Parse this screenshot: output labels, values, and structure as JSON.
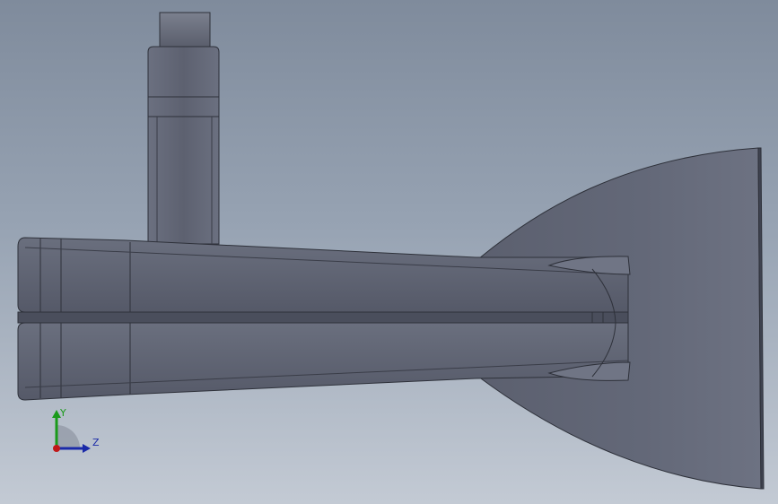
{
  "viewport": {
    "background_top": "#7f8b9c",
    "background_bottom": "#c3cad4"
  },
  "model": {
    "body_color": "#5f6372",
    "edge_color": "#2a2d36",
    "highlight_color": "#8a8f9d"
  },
  "triad": {
    "y_label": "Y",
    "z_label": "Z",
    "y_color": "#1a9a1a",
    "z_color": "#1a2aa8",
    "x_color": "#c01818"
  }
}
